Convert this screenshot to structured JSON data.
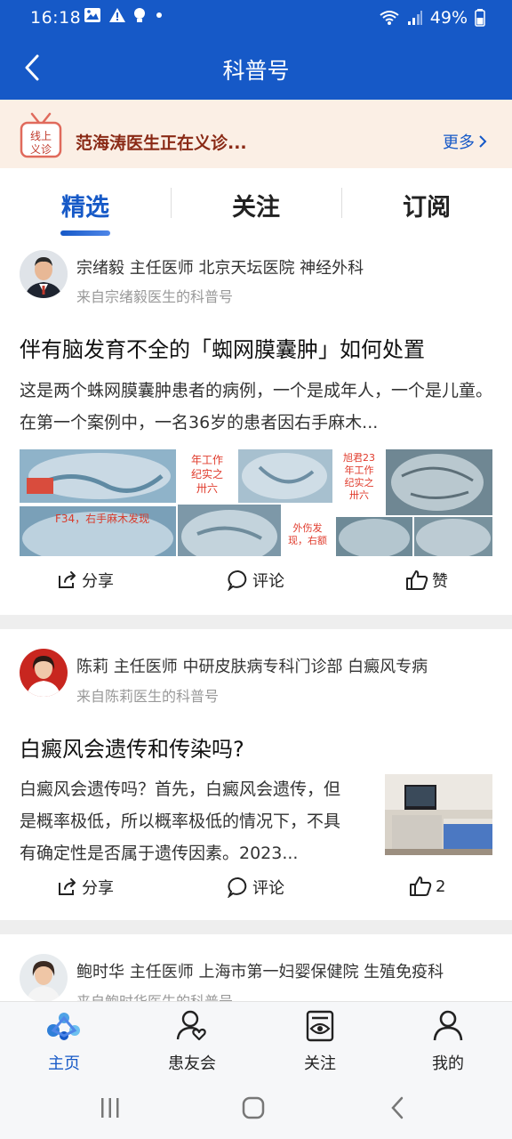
{
  "status_bar": {
    "time": "16:18",
    "battery": "49%"
  },
  "header": {
    "title": "科普号"
  },
  "banner": {
    "tag_line1": "线上",
    "tag_line2": "义诊",
    "message": "范海涛医生正在义诊...",
    "more": "更多"
  },
  "tabs": [
    {
      "label": "精选",
      "active": true
    },
    {
      "label": "关注",
      "active": false
    },
    {
      "label": "订阅",
      "active": false
    }
  ],
  "posts": [
    {
      "author": "宗绪毅 主任医师 北京天坛医院 神经外科",
      "source": "来自宗绪毅医生的科普号",
      "title": "伴有脑发育不全的「蜘网膜囊肿」如何处置",
      "excerpt": "这是两个蛛网膜囊肿患者的病例，一个是成年人，一个是儿童。在第一个案例中，一名36岁的患者因右手麻木...",
      "image_captions": [
        "年工作纪实之卅六",
        "旭君23年工作纪实之卅六",
        "F34，右手麻木发现",
        "外伤发现，右额"
      ],
      "share": "分享",
      "comment": "评论",
      "like": "赞"
    },
    {
      "author": "陈莉 主任医师 中研皮肤病专科门诊部 白癜风专病",
      "source": "来自陈莉医生的科普号",
      "title": "白癜风会遗传和传染吗?",
      "excerpt": "白癜风会遗传吗？首先，白癜风会遗传，但是概率极低，所以概率极低的情况下，不具有确定性是否属于遗传因素。2023...",
      "share": "分享",
      "comment": "评论",
      "like": "2"
    },
    {
      "author": "鲍时华 主任医师 上海市第一妇婴保健院 生殖免疫科",
      "source": "来自鲍时华医生的科普号"
    }
  ],
  "bottom_nav": [
    {
      "label": "主页",
      "icon": "home-molecule-icon",
      "active": true
    },
    {
      "label": "患友会",
      "icon": "patient-group-icon",
      "active": false
    },
    {
      "label": "关注",
      "icon": "follow-eye-icon",
      "active": false
    },
    {
      "label": "我的",
      "icon": "person-icon",
      "active": false
    }
  ],
  "colors": {
    "brand": "#1659c7",
    "banner_bg": "#fbefe5",
    "banner_text": "#8a2a16"
  }
}
